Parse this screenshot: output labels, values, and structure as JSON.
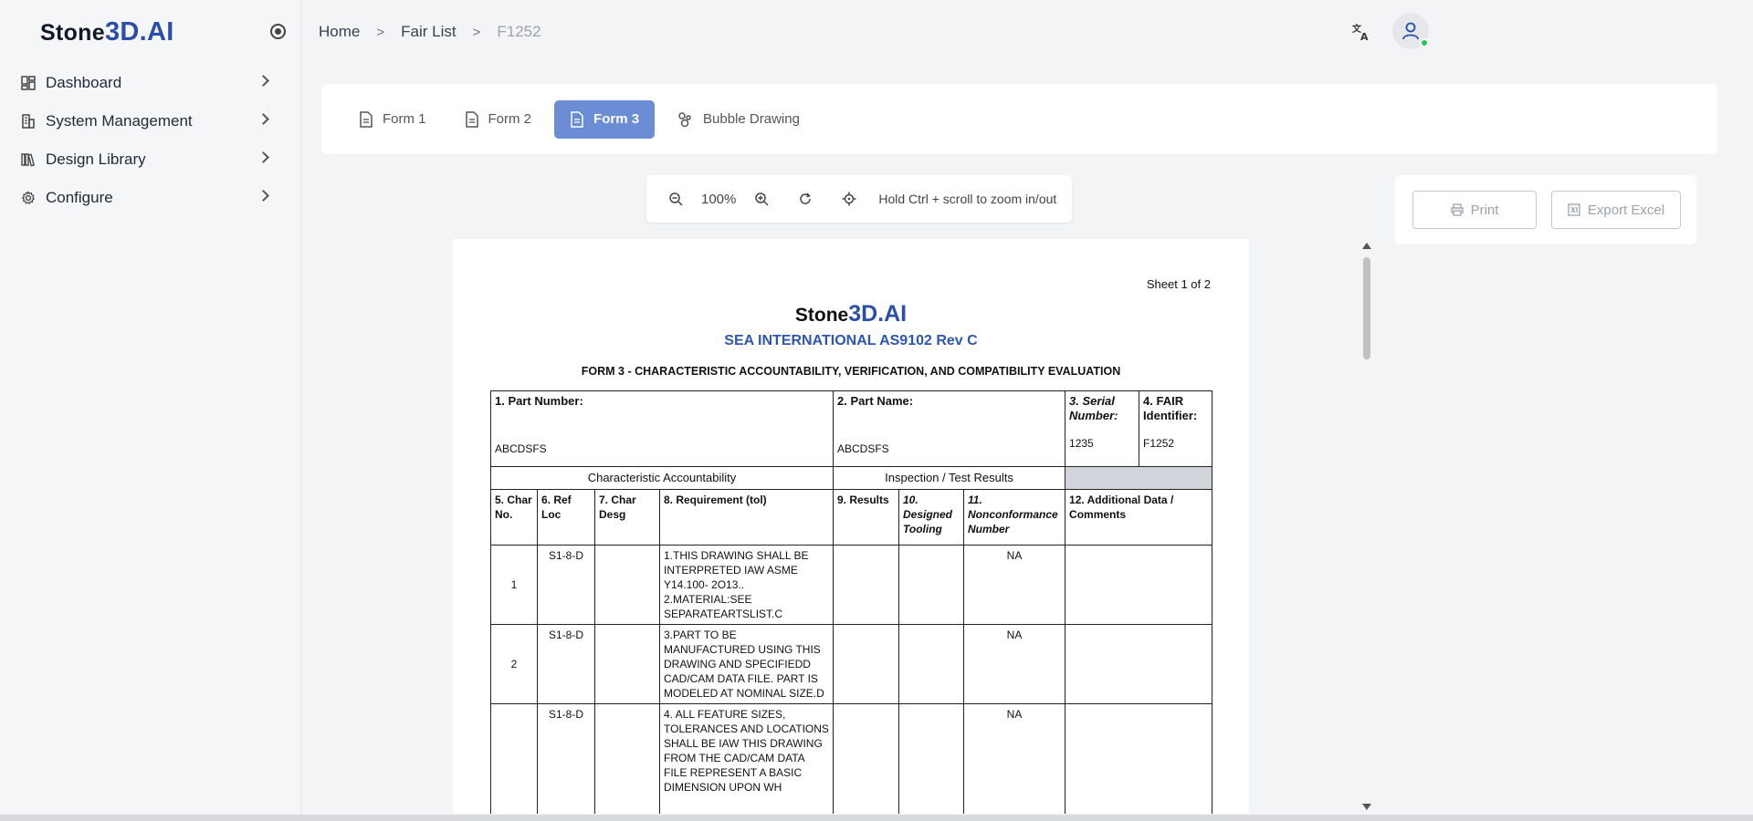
{
  "app": {
    "logo_part1": "Stone",
    "logo_part2": "3D.AI"
  },
  "sidebar": {
    "items": [
      {
        "label": "Dashboard",
        "icon": "dashboard-icon"
      },
      {
        "label": "System Management",
        "icon": "building-icon"
      },
      {
        "label": "Design Library",
        "icon": "library-icon"
      },
      {
        "label": "Configure",
        "icon": "gear-icon"
      }
    ]
  },
  "breadcrumb": {
    "items": [
      "Home",
      "Fair List",
      "F1252"
    ]
  },
  "tabs": [
    {
      "label": "Form 1",
      "active": false
    },
    {
      "label": "Form 2",
      "active": false
    },
    {
      "label": "Form 3",
      "active": true
    },
    {
      "label": "Bubble Drawing",
      "active": false
    }
  ],
  "zoom": {
    "level": "100%",
    "hint": "Hold Ctrl + scroll to zoom in/out"
  },
  "actions": {
    "print": "Print",
    "export": "Export Excel"
  },
  "document": {
    "sheet": "Sheet 1 of 2",
    "logo_part1": "Stone",
    "logo_part2": "3D.AI",
    "standard": "SEA INTERNATIONAL AS9102 Rev C",
    "form_title": "FORM 3 - CHARACTERISTIC ACCOUNTABILITY, VERIFICATION, AND COMPATIBILITY EVALUATION",
    "part_number_label": "1. Part Number:",
    "part_number": "ABCDSFS",
    "part_name_label": "2. Part Name:",
    "part_name": "ABCDSFS",
    "serial_label": "3. Serial Number:",
    "serial": "1235",
    "fair_label": "4. FAIR Identifier:",
    "fair": "F1252",
    "section_char": "Characteristic Accountability",
    "section_insp": "Inspection / Test Results",
    "col_char_no": "5. Char No.",
    "col_ref_loc": "6. Ref Loc",
    "col_char_desg": "7. Char Desg",
    "col_requirement": "8. Requirement (tol)",
    "col_results": "9. Results",
    "col_tooling": "10. Designed Tooling",
    "col_nonconf": "11. Nonconformance Number",
    "col_additional": "12. Additional Data / Comments",
    "rows": [
      {
        "no": "1",
        "ref": "S1-8-D",
        "req": "1.THIS DRAWING SHALL BE INTERPRETED IAW ASME Y14.100- 2O13..\n2.MATERIAL:SEE SEPARATEARTSLIST.C",
        "nc": "NA"
      },
      {
        "no": "2",
        "ref": "S1-8-D",
        "req": "3.PART TO BE MANUFACTURED USING THIS DRAWING AND SPECIFIEDD CAD/CAM DATA FILE. PART IS MODELED AT NOMINAL SIZE.D",
        "nc": "NA"
      },
      {
        "no": "",
        "ref": "S1-8-D",
        "req": "4. ALL FEATURE SIZES, TOLERANCES AND LOCATIONS SHALL BE IAW THIS DRAWING\nFROM THE CAD/CAM DATA FILE REPRESENT A BASIC DIMENSION UPON WH",
        "nc": "NA"
      }
    ]
  }
}
